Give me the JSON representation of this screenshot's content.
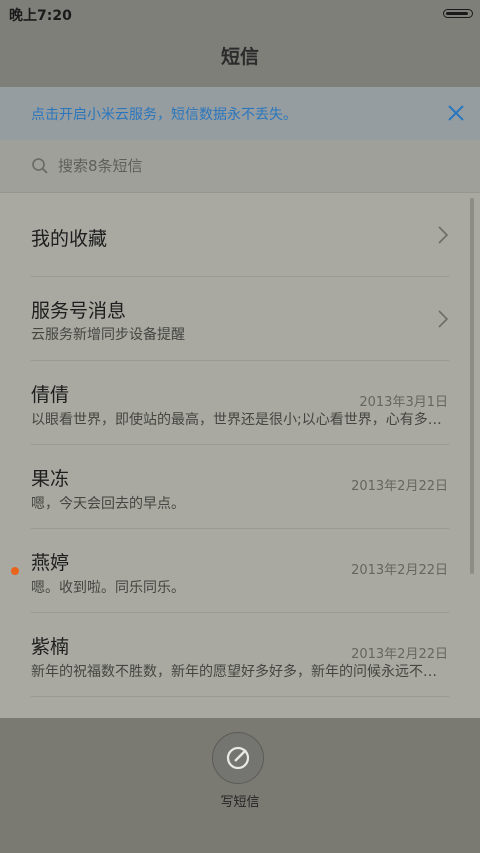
{
  "status": {
    "time": "晚上7:20",
    "battery_level": 0.95
  },
  "header": {
    "title": "短信"
  },
  "cloud_banner": {
    "text": "点击开启小米云服务，短信数据永不丢失。"
  },
  "search": {
    "placeholder": "搜索8条短信"
  },
  "folders": [
    {
      "title": "我的收藏"
    },
    {
      "title": "服务号消息",
      "subtitle": "云服务新增同步设备提醒"
    }
  ],
  "conversations": [
    {
      "name": "倩倩",
      "date": "2013年3月1日",
      "preview": "以眼看世界，即使站的最高，世界还是很小;以心看世界，心有多宽世界就有多大。",
      "unread": false
    },
    {
      "name": "果冻",
      "date": "2013年2月22日",
      "preview": "嗯，今天会回去的早点。",
      "unread": false
    },
    {
      "name": "燕婷",
      "date": "2013年2月22日",
      "preview": "嗯。收到啦。同乐同乐。",
      "unread": true
    },
    {
      "name": "紫楠",
      "date": "2013年2月22日",
      "preview": "新年的祝福数不胜数，新年的愿望好多好多，新年的问候永远不变。",
      "unread": false
    }
  ],
  "compose": {
    "label": "写短信"
  },
  "colors": {
    "accent": "#2a76bd",
    "unread_dot": "#e8641c"
  }
}
